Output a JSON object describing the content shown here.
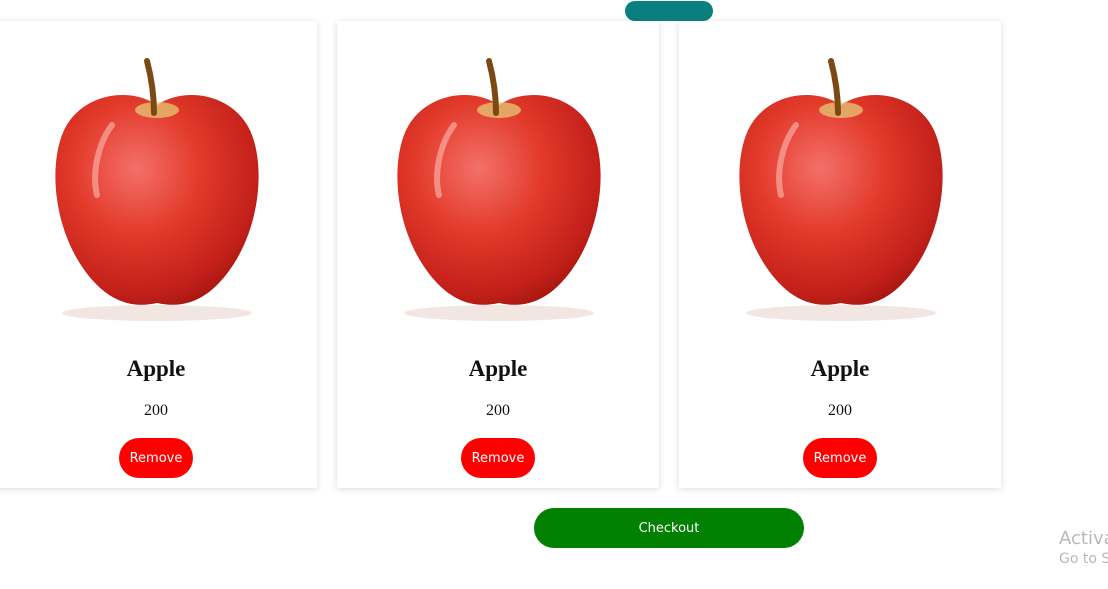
{
  "products": [
    {
      "name": "Apple",
      "price": "200",
      "remove_label": "Remove",
      "image": "red-apple"
    },
    {
      "name": "Apple",
      "price": "200",
      "remove_label": "Remove",
      "image": "red-apple"
    },
    {
      "name": "Apple",
      "price": "200",
      "remove_label": "Remove",
      "image": "red-apple"
    }
  ],
  "checkout": {
    "label": "Checkout",
    "color": "#018001"
  },
  "top_indicator": {
    "color": "#0a7f80"
  },
  "remove_button_color": "#ff0000",
  "watermark": {
    "line1": "Activa",
    "line2": "Go to S"
  }
}
